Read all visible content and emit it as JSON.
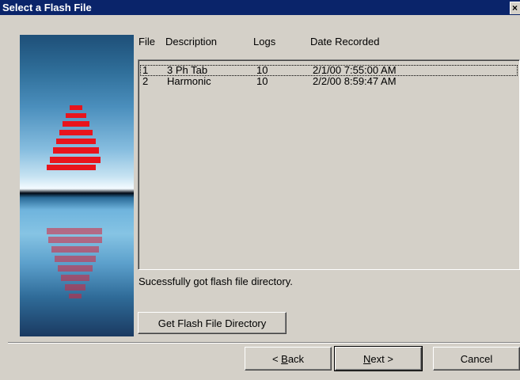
{
  "window": {
    "title": "Select a Flash File",
    "close_glyph": "×"
  },
  "columns": {
    "file": "File",
    "description": "Description",
    "logs": "Logs",
    "date": "Date Recorded"
  },
  "rows": [
    {
      "file": "1",
      "description": "3 Ph Tab",
      "logs": "10",
      "date": "2/1/00 7:55:00 AM"
    },
    {
      "file": "2",
      "description": "Harmonic",
      "logs": "10",
      "date": "2/2/00 8:59:47 AM"
    }
  ],
  "status_text": "Sucessfully got flash file directory.",
  "buttons": {
    "get_directory": "Get Flash File Directory",
    "back_pre": "< ",
    "back_key": "B",
    "back_post": "ack",
    "next_key": "N",
    "next_post": "ext >",
    "cancel": "Cancel"
  },
  "icons": {
    "logo": "logo-icon",
    "close": "close-icon"
  },
  "colors": {
    "title_bar": "#0a246a",
    "logo_red": "#e8141c",
    "face": "#d4d0c8"
  }
}
